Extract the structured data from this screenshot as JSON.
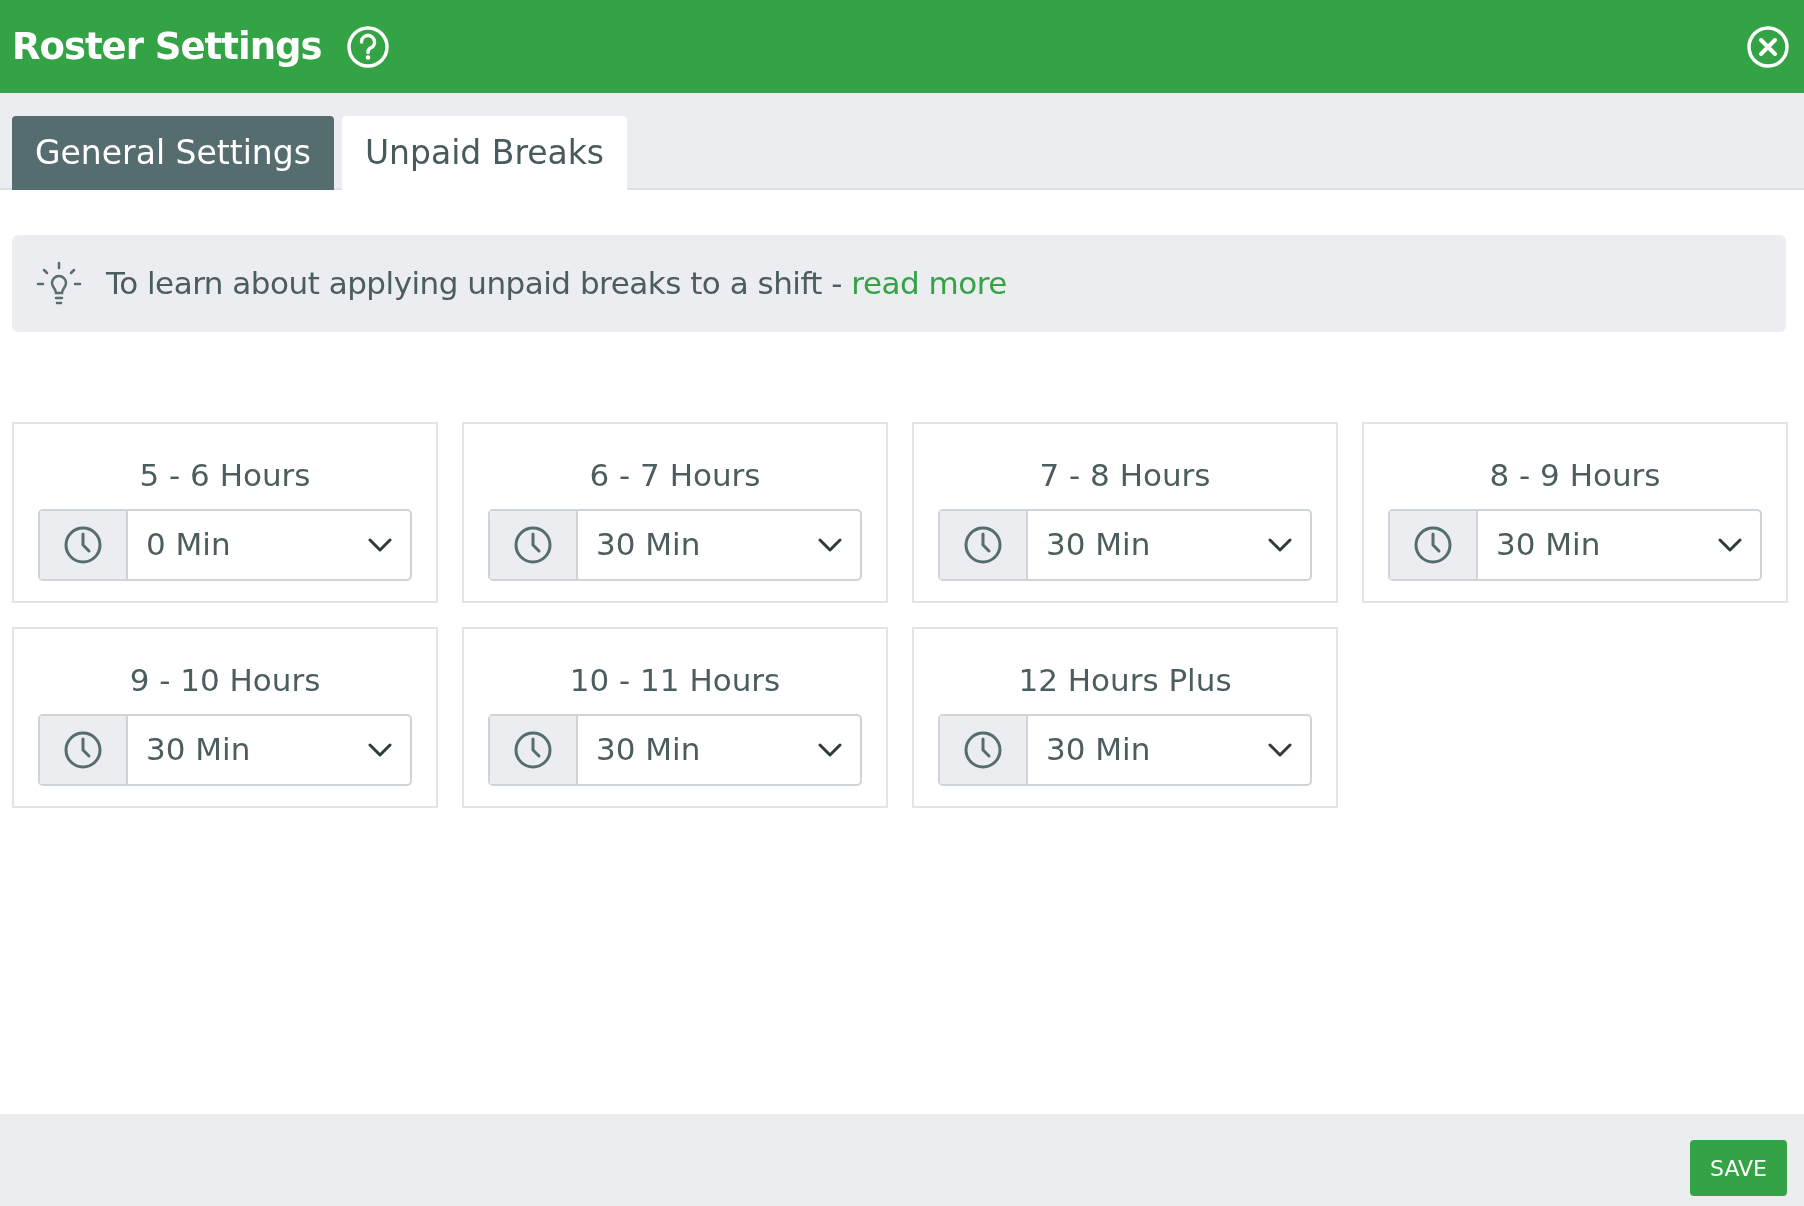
{
  "header": {
    "title": "Roster Settings"
  },
  "tabs": [
    {
      "label": "General Settings",
      "selected": false
    },
    {
      "label": "Unpaid Breaks",
      "selected": true
    }
  ],
  "info": {
    "text": "To learn about applying unpaid breaks to a shift - ",
    "link": "read more"
  },
  "breaks": [
    {
      "label": "5 - 6 Hours",
      "value": "0 Min"
    },
    {
      "label": "6 - 7 Hours",
      "value": "30 Min"
    },
    {
      "label": "7 - 8 Hours",
      "value": "30 Min"
    },
    {
      "label": "8 - 9 Hours",
      "value": "30 Min"
    },
    {
      "label": "9 - 10 Hours",
      "value": "30 Min"
    },
    {
      "label": "10 - 11 Hours",
      "value": "30 Min"
    },
    {
      "label": "12 Hours Plus",
      "value": "30 Min"
    }
  ],
  "footer": {
    "save": "SAVE"
  }
}
